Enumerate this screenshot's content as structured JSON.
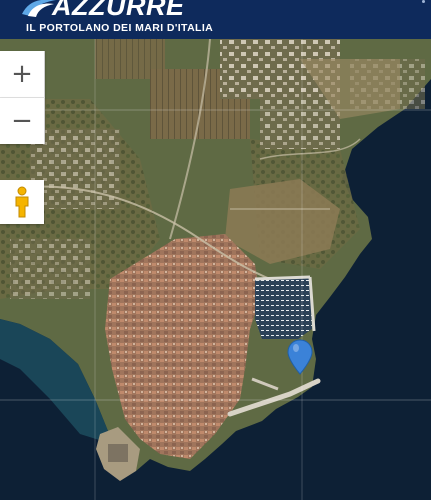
{
  "header": {
    "title": "AZZURRE",
    "subtitle": "IL PORTOLANO DEI MARI D'ITALIA"
  },
  "map": {
    "type": "satellite",
    "controls": {
      "zoom_in_label": "+",
      "zoom_out_label": "−",
      "street_view_icon": "pegman-icon"
    },
    "marker_icon": "map-pin-icon",
    "colors": {
      "header_bg": "#0e2a5c",
      "sea": "#0d2035",
      "marker": "#3b82d8"
    }
  }
}
